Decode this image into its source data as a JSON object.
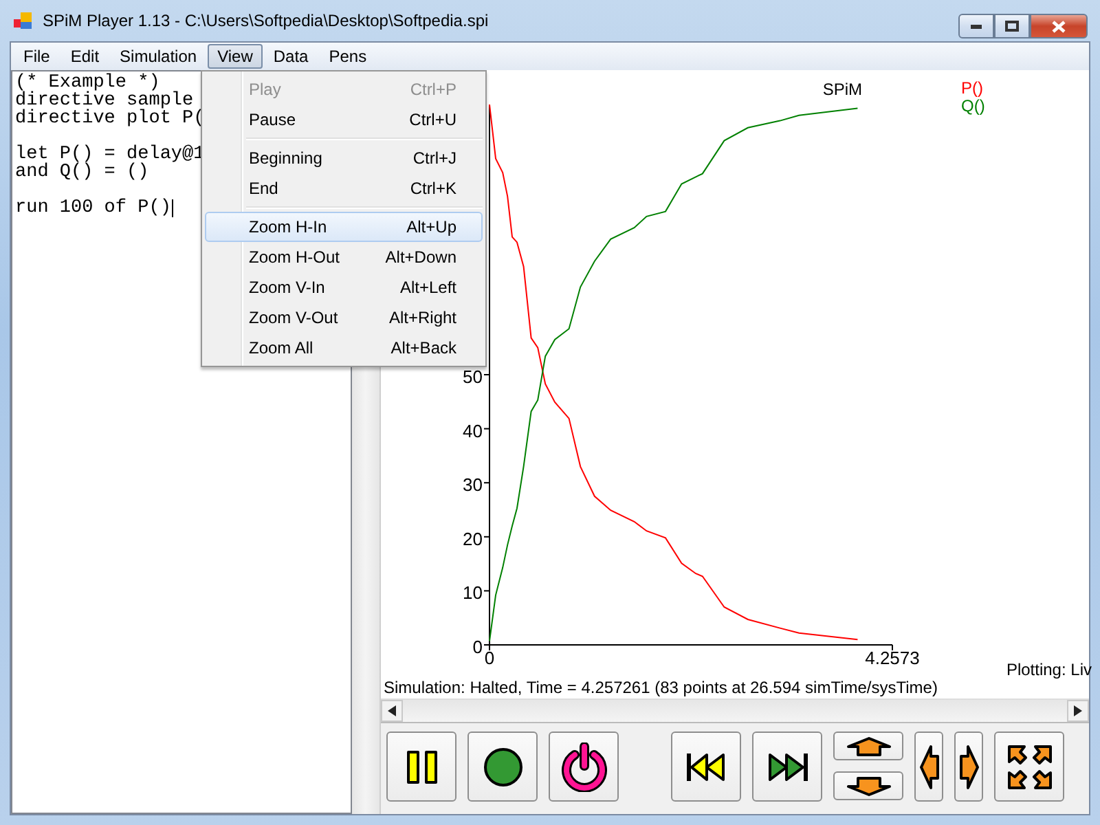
{
  "window": {
    "title": "SPiM Player 1.13 - C:\\Users\\Softpedia\\Desktop\\Softpedia.spi"
  },
  "menu_bar": [
    {
      "label": "File",
      "selected": false
    },
    {
      "label": "Edit",
      "selected": false
    },
    {
      "label": "Simulation",
      "selected": false
    },
    {
      "label": "View",
      "selected": true
    },
    {
      "label": "Data",
      "selected": false
    },
    {
      "label": "Pens",
      "selected": false
    }
  ],
  "view_menu": {
    "groups": [
      [
        {
          "label": "Play",
          "shortcut": "Ctrl+P",
          "disabled": true,
          "selected": false
        },
        {
          "label": "Pause",
          "shortcut": "Ctrl+U",
          "disabled": false,
          "selected": false
        }
      ],
      [
        {
          "label": "Beginning",
          "shortcut": "Ctrl+J",
          "disabled": false,
          "selected": false
        },
        {
          "label": "End",
          "shortcut": "Ctrl+K",
          "disabled": false,
          "selected": false
        }
      ],
      [
        {
          "label": "Zoom H-In",
          "shortcut": "Alt+Up",
          "disabled": false,
          "selected": true
        },
        {
          "label": "Zoom H-Out",
          "shortcut": "Alt+Down",
          "disabled": false,
          "selected": false
        },
        {
          "label": "Zoom V-In",
          "shortcut": "Alt+Left",
          "disabled": false,
          "selected": false
        },
        {
          "label": "Zoom V-Out",
          "shortcut": "Alt+Right",
          "disabled": false,
          "selected": false
        },
        {
          "label": "Zoom All",
          "shortcut": "Alt+Back",
          "disabled": false,
          "selected": false
        }
      ]
    ]
  },
  "editor": {
    "blocks": [
      [
        "(* Example *)",
        "directive sample",
        "directive plot P("
      ],
      [
        "let P() = delay@1",
        "and Q() = ()"
      ],
      [
        "run 100 of P()"
      ]
    ]
  },
  "plot": {
    "chart_data": {
      "type": "line",
      "title": "SPiM",
      "xlim": [
        0,
        4.2573
      ],
      "ylim": [
        0,
        100
      ],
      "xticks": [
        0,
        4.2573
      ],
      "yticks": [
        0,
        10,
        20,
        30,
        40,
        50
      ],
      "x": [
        0,
        0.065,
        0.14,
        0.19,
        0.24,
        0.29,
        0.36,
        0.44,
        0.51,
        0.59,
        0.69,
        0.84,
        0.96,
        1.11,
        1.28,
        1.53,
        1.66,
        1.86,
        2.03,
        2.18,
        2.25,
        2.48,
        2.73,
        3.07,
        3.27,
        3.89
      ],
      "series": [
        {
          "name": "P()",
          "color": "#ff0000",
          "values": [
            100,
            90,
            87.4,
            83,
            75.5,
            74.5,
            70,
            56.8,
            55,
            48.3,
            44.9,
            41.9,
            33,
            27.5,
            24.9,
            22.8,
            21.1,
            19.8,
            15.1,
            13.2,
            12.7,
            7,
            4.7,
            3.1,
            2.2,
            1
          ]
        },
        {
          "name": "Q()",
          "color": "#008000",
          "values": [
            0.7,
            9.2,
            14.3,
            18.5,
            22,
            25.3,
            33,
            43.2,
            45.3,
            53.4,
            56.5,
            58.5,
            66.2,
            71,
            75.1,
            77.2,
            79.3,
            80.2,
            85.3,
            86.6,
            87.2,
            93.3,
            95.7,
            97,
            98,
            99.3
          ]
        }
      ]
    }
  },
  "plotting_mode": "Plotting: Liv",
  "status": "Simulation: Halted, Time = 4.257261 (83 points at 26.594 simTime/sysTime)",
  "controls": [
    {
      "kind": "pause"
    },
    {
      "kind": "start"
    },
    {
      "kind": "power"
    },
    {
      "kind": "rewind"
    },
    {
      "kind": "forward"
    },
    {
      "kind": "updown"
    },
    {
      "kind": "left"
    },
    {
      "kind": "right"
    },
    {
      "kind": "zoomall"
    }
  ]
}
